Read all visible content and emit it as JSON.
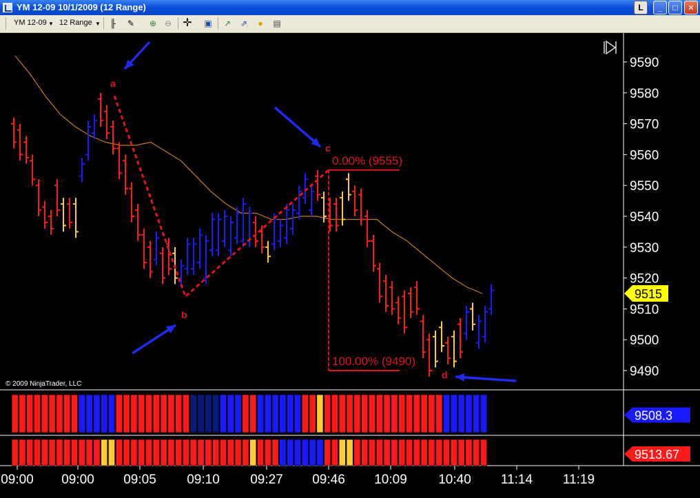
{
  "window": {
    "title": "YM 12-09  10/1/2009 (12 Range)",
    "buttons": {
      "layout": "L",
      "minimize": "_",
      "maximize": "□",
      "close": "×"
    }
  },
  "toolbar": {
    "instrument": "YM 12-09",
    "period": "12 Range",
    "icons": [
      "bar-type-icon",
      "draw-pen-icon",
      "zoom-in-icon",
      "zoom-out-icon",
      "crosshair-icon",
      "properties-icon",
      "indicators-icon",
      "strategies-icon",
      "trade-icon",
      "data-box-icon"
    ]
  },
  "chart_data": {
    "type": "bar",
    "symbol": "YM 12-09",
    "copyright": "© 2009 NinjaTrader, LLC",
    "y_range": [
      9485,
      9597
    ],
    "y_ticks": [
      9490,
      9500,
      9510,
      9520,
      9530,
      9540,
      9550,
      9560,
      9570,
      9580,
      9590
    ],
    "x_ticks": [
      "09:00",
      "09:00",
      "09:05",
      "09:10",
      "09:27",
      "09:46",
      "10:09",
      "10:40",
      "11:14",
      "11:19"
    ],
    "last_price": "9515",
    "colors": {
      "up": "#1a1aff",
      "down": "#ff1a1a",
      "neutral": "#ffcc33",
      "ma": "#cc7a1a",
      "fib": "#e0141e",
      "arrow": "#1f2cf0",
      "label_last": "#ffff00"
    },
    "bars": [
      {
        "h": 9572,
        "l": 9562,
        "c": "down"
      },
      {
        "h": 9570,
        "l": 9558,
        "c": "down"
      },
      {
        "h": 9566,
        "l": 9557,
        "c": "down"
      },
      {
        "h": 9560,
        "l": 9550,
        "c": "down"
      },
      {
        "h": 9552,
        "l": 9540,
        "c": "down"
      },
      {
        "h": 9545,
        "l": 9536,
        "c": "down"
      },
      {
        "h": 9542,
        "l": 9534,
        "c": "down"
      },
      {
        "h": 9552,
        "l": 9540,
        "c": "down"
      },
      {
        "h": 9546,
        "l": 9535,
        "c": "neutral"
      },
      {
        "h": 9546,
        "l": 9536,
        "c": "down"
      },
      {
        "h": 9546,
        "l": 9533,
        "c": "neutral"
      },
      {
        "h": 9559,
        "l": 9551,
        "c": "up"
      },
      {
        "h": 9571,
        "l": 9558,
        "c": "up"
      },
      {
        "h": 9573,
        "l": 9565,
        "c": "up"
      },
      {
        "h": 9580,
        "l": 9569,
        "c": "down"
      },
      {
        "h": 9576,
        "l": 9565,
        "c": "down"
      },
      {
        "h": 9571,
        "l": 9560,
        "c": "down"
      },
      {
        "h": 9564,
        "l": 9552,
        "c": "down"
      },
      {
        "h": 9560,
        "l": 9547,
        "c": "down"
      },
      {
        "h": 9551,
        "l": 9538,
        "c": "down"
      },
      {
        "h": 9544,
        "l": 9532,
        "c": "down"
      },
      {
        "h": 9536,
        "l": 9523,
        "c": "down"
      },
      {
        "h": 9532,
        "l": 9520,
        "c": "down"
      },
      {
        "h": 9535,
        "l": 9524,
        "c": "up"
      },
      {
        "h": 9530,
        "l": 9518,
        "c": "down"
      },
      {
        "h": 9533,
        "l": 9521,
        "c": "down"
      },
      {
        "h": 9530,
        "l": 9518,
        "c": "neutral"
      },
      {
        "h": 9526,
        "l": 9517,
        "c": "up"
      },
      {
        "h": 9533,
        "l": 9521,
        "c": "up"
      },
      {
        "h": 9533,
        "l": 9521,
        "c": "up"
      },
      {
        "h": 9536,
        "l": 9523,
        "c": "up"
      },
      {
        "h": 9534,
        "l": 9518,
        "c": "up"
      },
      {
        "h": 9541,
        "l": 9527,
        "c": "up"
      },
      {
        "h": 9541,
        "l": 9527,
        "c": "up"
      },
      {
        "h": 9542,
        "l": 9530,
        "c": "up"
      },
      {
        "h": 9540,
        "l": 9527,
        "c": "up"
      },
      {
        "h": 9543,
        "l": 9531,
        "c": "up"
      },
      {
        "h": 9546,
        "l": 9530,
        "c": "up"
      },
      {
        "h": 9543,
        "l": 9530,
        "c": "up"
      },
      {
        "h": 9540,
        "l": 9530,
        "c": "down"
      },
      {
        "h": 9537,
        "l": 9528,
        "c": "down"
      },
      {
        "h": 9532,
        "l": 9525,
        "c": "neutral"
      },
      {
        "h": 9541,
        "l": 9529,
        "c": "up"
      },
      {
        "h": 9539,
        "l": 9530,
        "c": "up"
      },
      {
        "h": 9544,
        "l": 9531,
        "c": "up"
      },
      {
        "h": 9544,
        "l": 9534,
        "c": "up"
      },
      {
        "h": 9550,
        "l": 9539,
        "c": "up"
      },
      {
        "h": 9554,
        "l": 9544,
        "c": "up"
      },
      {
        "h": 9550,
        "l": 9540,
        "c": "up"
      },
      {
        "h": 9555,
        "l": 9545,
        "c": "down"
      },
      {
        "h": 9548,
        "l": 9538,
        "c": "neutral"
      },
      {
        "h": 9546,
        "l": 9535,
        "c": "down"
      },
      {
        "h": 9546,
        "l": 9535,
        "c": "down"
      },
      {
        "h": 9548,
        "l": 9537,
        "c": "neutral"
      },
      {
        "h": 9554,
        "l": 9545,
        "c": "neutral"
      },
      {
        "h": 9550,
        "l": 9540,
        "c": "down"
      },
      {
        "h": 9549,
        "l": 9537,
        "c": "down"
      },
      {
        "h": 9542,
        "l": 9530,
        "c": "down"
      },
      {
        "h": 9534,
        "l": 9522,
        "c": "down"
      },
      {
        "h": 9525,
        "l": 9512,
        "c": "down"
      },
      {
        "h": 9521,
        "l": 9509,
        "c": "down"
      },
      {
        "h": 9519,
        "l": 9508,
        "c": "down"
      },
      {
        "h": 9514,
        "l": 9505,
        "c": "down"
      },
      {
        "h": 9516,
        "l": 9502,
        "c": "down"
      },
      {
        "h": 9517,
        "l": 9507,
        "c": "down"
      },
      {
        "h": 9519,
        "l": 9508,
        "c": "down"
      },
      {
        "h": 9508,
        "l": 9494,
        "c": "down"
      },
      {
        "h": 9502,
        "l": 9488,
        "c": "down"
      },
      {
        "h": 9503,
        "l": 9491,
        "c": "neutral"
      },
      {
        "h": 9506,
        "l": 9496,
        "c": "neutral"
      },
      {
        "h": 9501,
        "l": 9492,
        "c": "down"
      },
      {
        "h": 9503,
        "l": 9491,
        "c": "neutral"
      },
      {
        "h": 9507,
        "l": 9494,
        "c": "down"
      },
      {
        "h": 9511,
        "l": 9500,
        "c": "up"
      },
      {
        "h": 9512,
        "l": 9503,
        "c": "neutral"
      },
      {
        "h": 9508,
        "l": 9497,
        "c": "up"
      },
      {
        "h": 9511,
        "l": 9499,
        "c": "up"
      },
      {
        "h": 9518,
        "l": 9508,
        "c": "up"
      }
    ],
    "moving_average": [
      9592,
      9586,
      9579,
      9573,
      9569,
      9566,
      9564,
      9563,
      9563,
      9564,
      9561,
      9558,
      9553,
      9548,
      9544,
      9541,
      9541,
      9539,
      9539,
      9540,
      9540,
      9539,
      9539,
      9539,
      9539,
      9535,
      9532,
      9528,
      9524,
      9520,
      9517,
      9515
    ],
    "fibonacci": {
      "top_label": "0.00% (9555)",
      "top_value": 9555,
      "bottom_label": "100.00% (9490)",
      "bottom_value": 9490
    },
    "points": [
      {
        "label": "a",
        "value": 9579
      },
      {
        "label": "b",
        "value": 9514
      },
      {
        "label": "c",
        "value": 9555
      },
      {
        "label": "d",
        "value": 9490
      }
    ],
    "indicator1": {
      "last_value": "9508.3",
      "colors": [
        "down",
        "down",
        "down",
        "down",
        "down",
        "down",
        "down",
        "down",
        "down",
        "up",
        "up",
        "up",
        "up",
        "up",
        "down",
        "down",
        "down",
        "down",
        "down",
        "down",
        "down",
        "down",
        "down",
        "down",
        "dark",
        "dark",
        "dark",
        "dark",
        "up",
        "up",
        "up",
        "down",
        "down",
        "up",
        "up",
        "up",
        "up",
        "up",
        "up",
        "down",
        "down",
        "neutral",
        "down",
        "down",
        "down",
        "down",
        "down",
        "down",
        "down",
        "down",
        "down",
        "down",
        "down",
        "down",
        "down",
        "down",
        "down",
        "down",
        "up",
        "up",
        "up",
        "up",
        "up",
        "up"
      ]
    },
    "indicator2": {
      "last_value": "9513.67",
      "colors": [
        "down",
        "down",
        "down",
        "down",
        "down",
        "down",
        "down",
        "down",
        "down",
        "down",
        "down",
        "down",
        "neutral",
        "neutral",
        "down",
        "down",
        "down",
        "down",
        "down",
        "down",
        "down",
        "down",
        "down",
        "down",
        "down",
        "down",
        "down",
        "down",
        "down",
        "down",
        "down",
        "down",
        "neutral",
        "down",
        "down",
        "down",
        "up",
        "up",
        "up",
        "up",
        "up",
        "up",
        "down",
        "down",
        "neutral",
        "neutral",
        "down",
        "down",
        "down",
        "down",
        "down",
        "down",
        "down",
        "down",
        "down",
        "down",
        "down",
        "down",
        "down",
        "down",
        "down",
        "down",
        "down",
        "down"
      ]
    }
  }
}
